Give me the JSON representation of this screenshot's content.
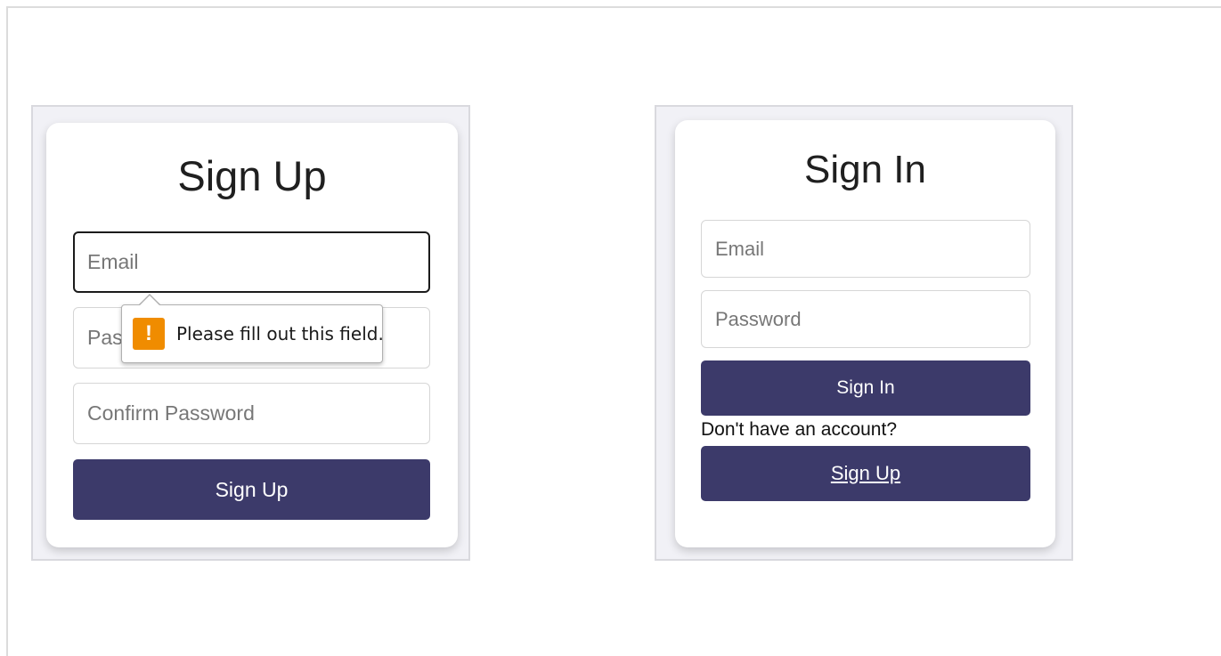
{
  "sign_up": {
    "title": "Sign Up",
    "email_placeholder": "Email",
    "password_placeholder": "Password",
    "password_visible_fragment": "Pas",
    "confirm_password_placeholder": "Confirm Password",
    "submit_label": "Sign Up",
    "validation_tooltip": {
      "icon": "warning-icon",
      "icon_glyph": "!",
      "message": "Please fill out this field."
    }
  },
  "sign_in": {
    "title": "Sign In",
    "email_placeholder": "Email",
    "password_placeholder": "Password",
    "submit_label": "Sign In",
    "no_account_prompt": "Don't have an account?",
    "goto_signup_label": "Sign Up"
  },
  "colors": {
    "button_bg": "#3c3a6a",
    "panel_bg": "#f1f1f6",
    "warning": "#f08c00"
  }
}
